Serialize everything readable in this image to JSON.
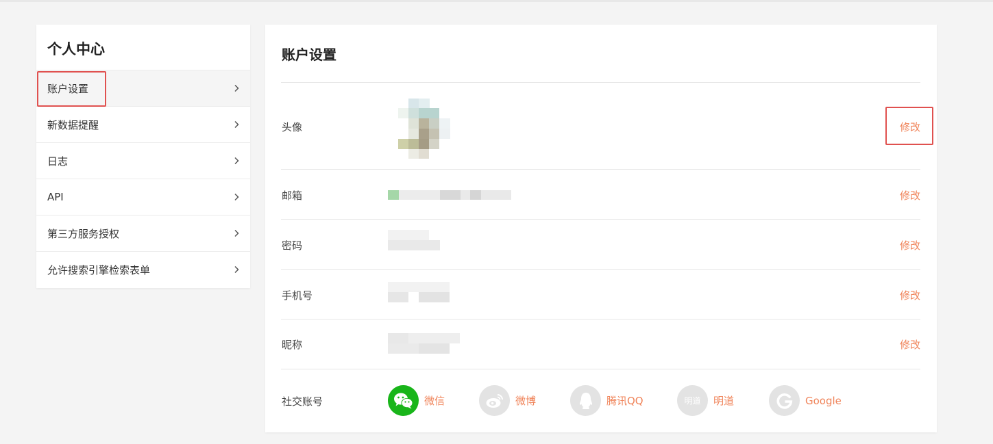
{
  "sidebar": {
    "title": "个人中心",
    "items": [
      {
        "label": "账户设置",
        "active": true
      },
      {
        "label": "新数据提醒"
      },
      {
        "label": "日志"
      },
      {
        "label": "API"
      },
      {
        "label": "第三方服务授权"
      },
      {
        "label": "允许搜索引擎检索表单"
      }
    ]
  },
  "main": {
    "title": "账户设置",
    "rows": [
      {
        "label": "头像",
        "action": "修改"
      },
      {
        "label": "邮箱",
        "action": "修改"
      },
      {
        "label": "密码",
        "action": "修改"
      },
      {
        "label": "手机号",
        "action": "修改"
      },
      {
        "label": "昵称",
        "action": "修改"
      }
    ],
    "social": {
      "label": "社交账号",
      "accounts": [
        {
          "name": "微信",
          "icon": "wechat-icon",
          "linked": true
        },
        {
          "name": "微博",
          "icon": "weibo-icon",
          "linked": false
        },
        {
          "name": "腾讯QQ",
          "icon": "qq-icon",
          "linked": false
        },
        {
          "name": "明道",
          "icon": "mingdao-icon",
          "linked": false,
          "icon_text": "明道"
        },
        {
          "name": "Google",
          "icon": "google-icon",
          "linked": false
        }
      ]
    }
  },
  "colors": {
    "accent": "#f0845a",
    "highlight": "#e0514f",
    "wechat": "#19b51a"
  }
}
